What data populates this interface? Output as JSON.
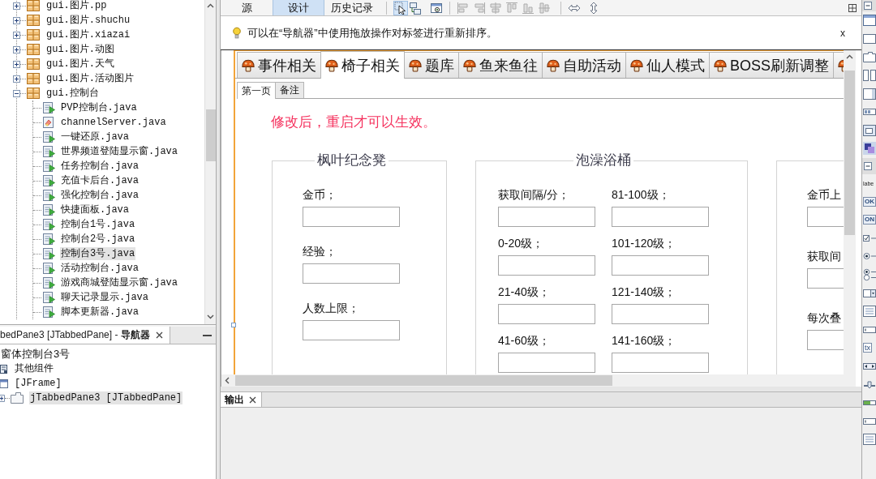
{
  "project_tree": {
    "items": [
      {
        "label": "gui.图片.pp",
        "expanded": false,
        "selected": false
      },
      {
        "label": "gui.图片.shuchu",
        "expanded": false,
        "selected": false
      },
      {
        "label": "gui.图片.xiazai",
        "expanded": false,
        "selected": false
      },
      {
        "label": "gui.图片.动图",
        "expanded": false,
        "selected": false
      },
      {
        "label": "gui.图片.天气",
        "expanded": false,
        "selected": false
      },
      {
        "label": "gui.图片.活动图片",
        "expanded": false,
        "selected": false
      },
      {
        "label": "gui.控制台",
        "expanded": true,
        "selected": false,
        "children": [
          {
            "label": "PVP控制台.java",
            "kind": "form",
            "selected": false
          },
          {
            "label": "channelServer.java",
            "kind": "class",
            "selected": false
          },
          {
            "label": "一键还原.java",
            "kind": "form",
            "selected": false
          },
          {
            "label": "世界频道登陆显示窗.java",
            "kind": "form",
            "selected": false
          },
          {
            "label": "任务控制台.java",
            "kind": "form",
            "selected": false
          },
          {
            "label": "充值卡后台.java",
            "kind": "form",
            "selected": false
          },
          {
            "label": "强化控制台.java",
            "kind": "form",
            "selected": false
          },
          {
            "label": "快捷面板.java",
            "kind": "form",
            "selected": false
          },
          {
            "label": "控制台1号.java",
            "kind": "form",
            "selected": false
          },
          {
            "label": "控制台2号.java",
            "kind": "form",
            "selected": false
          },
          {
            "label": "控制台3号.java",
            "kind": "form",
            "selected": true
          },
          {
            "label": "活动控制台.java",
            "kind": "form",
            "selected": false
          },
          {
            "label": "游戏商城登陆显示窗.java",
            "kind": "form",
            "selected": false
          },
          {
            "label": "聊天记录显示.java",
            "kind": "form",
            "selected": false
          },
          {
            "label": "脚本更新器.java",
            "kind": "form",
            "selected": false
          }
        ]
      }
    ]
  },
  "navigator": {
    "title": "bedPane3 [JTabbedPane] - **导航器**",
    "items": [
      {
        "label": "窗体控制台3号",
        "selected": false,
        "children": [
          {
            "label": "其他组件",
            "kind": "other",
            "selected": false
          },
          {
            "label": "[JFrame]",
            "kind": "frame",
            "selected": false,
            "children": [
              {
                "label": "jTabbedPane3 [JTabbedPane]",
                "kind": "tabbed",
                "expanded": false,
                "selected": true
              }
            ]
          }
        ]
      }
    ]
  },
  "editor": {
    "views": [
      {
        "label": "源",
        "selected": false
      },
      {
        "label": "设计",
        "selected": true
      },
      {
        "label": "历史记录",
        "selected": false
      }
    ],
    "modes": [
      {
        "kind": "select",
        "selected": true
      },
      {
        "kind": "connect",
        "selected": false
      }
    ],
    "hint": {
      "text": "可以在“导航器”中使用拖放操作对标签进行重新排序。",
      "close": "x"
    },
    "form": {
      "tabs": [
        {
          "label": "事件相关",
          "selected": false
        },
        {
          "label": "椅子相关",
          "selected": true
        },
        {
          "label": "题库",
          "selected": false
        },
        {
          "label": "鱼来鱼往",
          "selected": false
        },
        {
          "label": "自助活动",
          "selected": false
        },
        {
          "label": "仙人模式",
          "selected": false
        },
        {
          "label": "BOSS刷新调整",
          "selected": false
        },
        {
          "selected": false
        }
      ],
      "subtabs": [
        {
          "label": "第一页",
          "selected": true
        },
        {
          "label": "备注",
          "selected": false
        }
      ],
      "notice": "修改后，重启才可以生效。",
      "panels": [
        {
          "title": "枫叶纪念凳",
          "columns": [
            [
              "金币；",
              "经验；",
              "人数上限；"
            ]
          ]
        },
        {
          "title": "泡澡浴桶",
          "columns": [
            [
              "获取间隔/分；",
              "0-20级；",
              "21-40级；",
              "41-60级；"
            ],
            [
              "81-100级；",
              "101-120级；",
              "121-140级；",
              "141-160级；"
            ]
          ]
        },
        {
          "columns": [
            [
              "金币上",
              "获取间",
              "每次叠"
            ]
          ]
        }
      ]
    }
  },
  "output": {
    "tab": "输出"
  },
  "palette": [
    {
      "kind": "section",
      "expanded": true
    },
    {
      "kind": "window"
    },
    {
      "kind": "panel"
    },
    {
      "kind": "tabbed"
    },
    {
      "kind": "split"
    },
    {
      "kind": "scroll"
    },
    {
      "kind": "toolbar"
    },
    {
      "kind": "desktop"
    },
    {
      "kind": "layered"
    },
    {
      "kind": "section",
      "expanded": true
    },
    {
      "kind": "label",
      "text": "labe"
    },
    {
      "kind": "button",
      "text": "OK"
    },
    {
      "kind": "toggle",
      "text": "ON"
    },
    {
      "kind": "checkbox"
    },
    {
      "kind": "radio"
    },
    {
      "kind": "radio-group"
    },
    {
      "kind": "combo"
    },
    {
      "kind": "list"
    },
    {
      "kind": "textfield"
    },
    {
      "kind": "textarea",
      "text": "tx"
    },
    {
      "kind": "scrollbar"
    },
    {
      "kind": "slider"
    },
    {
      "kind": "progress"
    },
    {
      "kind": "textfield"
    },
    {
      "kind": "list"
    }
  ]
}
